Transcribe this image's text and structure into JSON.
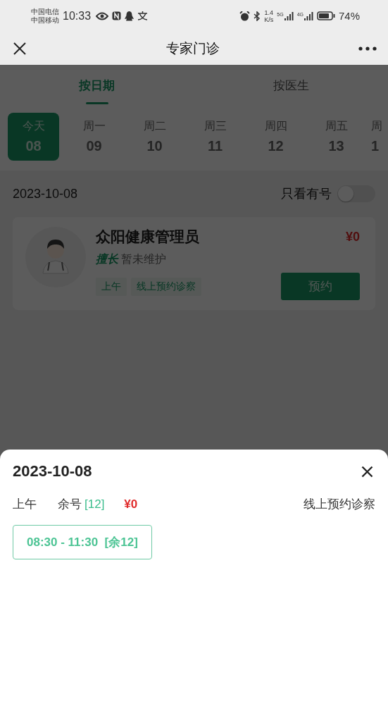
{
  "status_bar": {
    "carriers": [
      "中国电信",
      "中国移动"
    ],
    "time": "10:33",
    "net_speed": [
      "1.4",
      "K/s"
    ],
    "signals": [
      "5G",
      "4G"
    ],
    "battery": "74%"
  },
  "nav": {
    "title": "专家门诊"
  },
  "tabs": [
    {
      "label": "按日期",
      "selected": true
    },
    {
      "label": "按医生",
      "selected": false
    }
  ],
  "days": [
    {
      "weekday": "今天",
      "date": "08",
      "selected": true
    },
    {
      "weekday": "周一",
      "date": "09",
      "selected": false
    },
    {
      "weekday": "周二",
      "date": "10",
      "selected": false
    },
    {
      "weekday": "周三",
      "date": "11",
      "selected": false
    },
    {
      "weekday": "周四",
      "date": "12",
      "selected": false
    },
    {
      "weekday": "周五",
      "date": "13",
      "selected": false
    },
    {
      "weekday": "周",
      "date": "1",
      "selected": false
    }
  ],
  "date_bar": {
    "date": "2023-10-08",
    "filter_label": "只看有号",
    "filter_on": false
  },
  "doctors": [
    {
      "name": "众阳健康管理员",
      "price": "¥0",
      "specialty_label": "擅长",
      "specialty": "暂未维护",
      "tags": [
        "上午",
        "线上预约诊察"
      ],
      "button": "预约"
    }
  ],
  "sheet": {
    "date": "2023-10-08",
    "period": "上午",
    "remaining_label": "余号",
    "remaining": "[12]",
    "price": "¥0",
    "visit_type": "线上预约诊察",
    "slots": [
      {
        "time": "08:30 - 11:30",
        "remaining": "[余12]"
      }
    ]
  }
}
